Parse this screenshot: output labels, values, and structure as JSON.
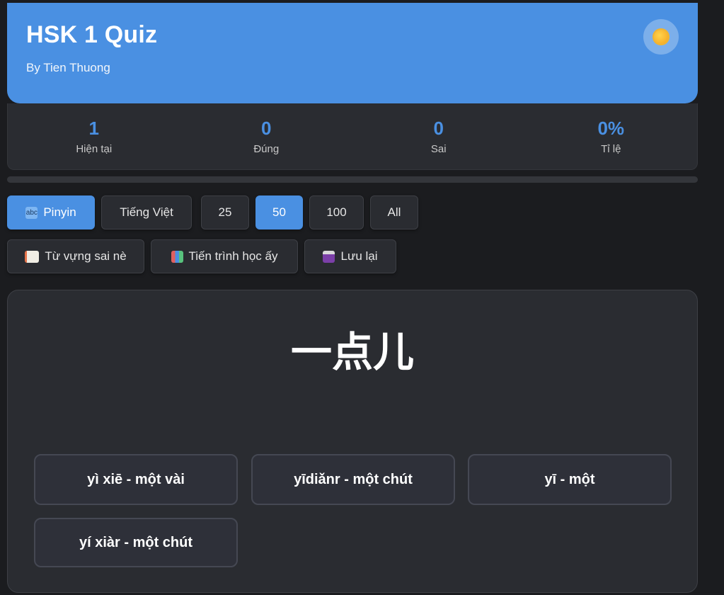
{
  "header": {
    "title": "HSK 1 Quiz",
    "subtitle": "By Tien Thuong",
    "theme_icon": "sun-icon"
  },
  "stats": [
    {
      "value": "1",
      "label": "Hiện tại"
    },
    {
      "value": "0",
      "label": "Đúng"
    },
    {
      "value": "0",
      "label": "Sai"
    },
    {
      "value": "0%",
      "label": "Tỉ lệ"
    }
  ],
  "progress": {
    "fraction": 0
  },
  "modes": {
    "pinyin": {
      "label": "Pinyin",
      "icon": "abc-icon",
      "active": true
    },
    "vietnamese": {
      "label": "Tiếng Việt",
      "active": false
    }
  },
  "counts": [
    {
      "label": "25",
      "active": false
    },
    {
      "label": "50",
      "active": true
    },
    {
      "label": "100",
      "active": false
    },
    {
      "label": "All",
      "active": false
    }
  ],
  "actions": [
    {
      "label": "Từ vựng sai nè",
      "icon": "memo-icon"
    },
    {
      "label": "Tiến trình học ấy",
      "icon": "bar-chart-icon"
    },
    {
      "label": "Lưu lại",
      "icon": "floppy-disk-icon"
    }
  ],
  "quiz": {
    "word": "一点儿",
    "options": [
      "yì xiē - một vài",
      "yīdiǎnr - một chút",
      "yī - một",
      "yí xiàr - một chút"
    ]
  },
  "colors": {
    "accent": "#4a90e2",
    "background": "#1b1c1f",
    "card": "#2a2c31"
  }
}
